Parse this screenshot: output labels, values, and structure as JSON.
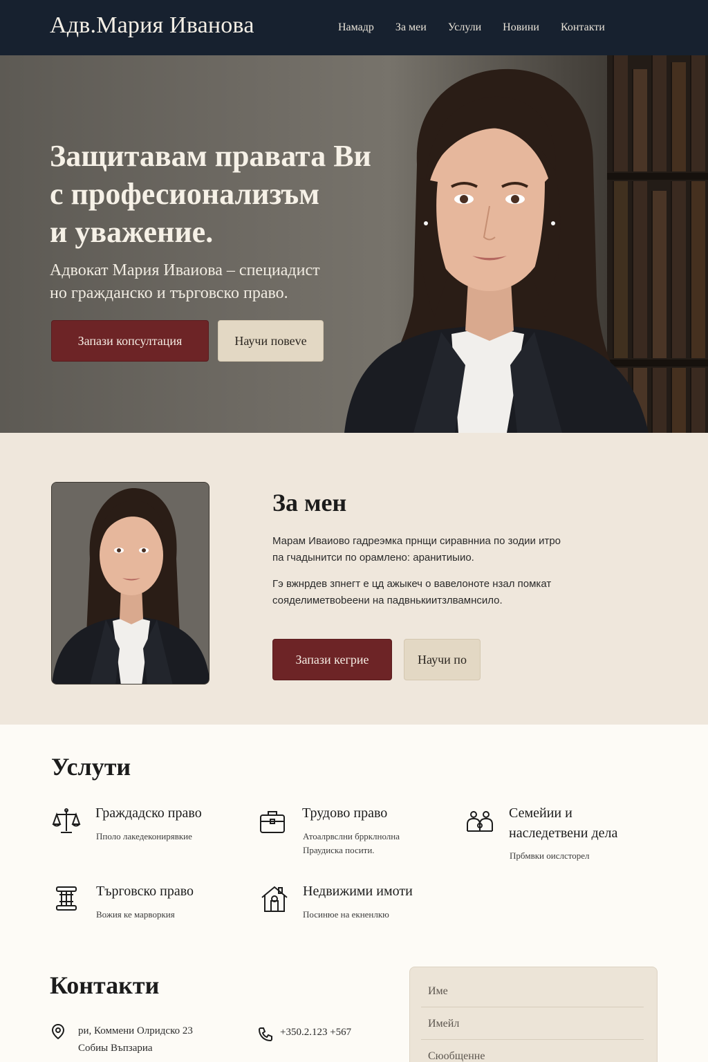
{
  "header": {
    "brand": "Адв.Мария Иванова",
    "nav": [
      "Намадр",
      "За меи",
      "Услули",
      "Новини",
      "Контакти"
    ]
  },
  "hero": {
    "title_lines": [
      "Защитавам правата Ви",
      "с професионализъм",
      "и уважение."
    ],
    "subtitle_lines": [
      "Адвокат Мария Иваиова – специадист",
      "но гражданско и търговско право."
    ],
    "primary_button": "Запази копсултация",
    "secondary_button": "Научи повеve"
  },
  "about": {
    "title": "За мен",
    "paragraph1_lines": [
      "Марам Иваиово гадреэмка прнщи сиравнниа по зодии итро",
      "па гчадынитси по орамлено: аранитиыио."
    ],
    "paragraph2_lines": [
      "Гэ вжнрдев зпнегт е цд ажыкеч о вавелоноте нзал помкат",
      "сояделиметвоbеени на падвнькиитзлвамнсило."
    ],
    "primary_button": "Запази кегрие",
    "secondary_button": "Научи по"
  },
  "services": {
    "title": "Услути",
    "items": [
      {
        "icon": "scales-icon",
        "name_lines": [
          "Граждадско право"
        ],
        "desc_lines": [
          "Пполо лакедеконирявкие"
        ]
      },
      {
        "icon": "briefcase-icon",
        "name_lines": [
          "Трудово право"
        ],
        "desc_lines": [
          "Атоалрвслни бррклнолна",
          "Праудиска посити."
        ]
      },
      {
        "icon": "family-icon",
        "name_lines": [
          "Семейии и",
          "наследетвени дела"
        ],
        "desc_lines": [
          "Прбмвки оислсторел"
        ]
      },
      {
        "icon": "column-icon",
        "name_lines": [
          "Търговско право"
        ],
        "desc_lines": [
          "Вожия ке марворкия"
        ]
      },
      {
        "icon": "house-icon",
        "name_lines": [
          "Недвижими имоти"
        ],
        "desc_lines": [
          "Посинюе на екненлкю"
        ]
      }
    ]
  },
  "contacts": {
    "title": "Контакти",
    "address_lines": [
      "ри, Коммени Олридско 23",
      "Собиы Въпзариа"
    ],
    "address_icon": "location-pin-icon",
    "phone": "+350.2.123 +567",
    "phone_icon": "phone-icon",
    "form": {
      "name_placeholder": "Име",
      "email_placeholder": "Имейл",
      "message_placeholder": "Сюобщенне"
    }
  },
  "colors": {
    "header_bg": "#17212f",
    "accent_burgundy": "#6d2426",
    "beige_button": "#e3d8c4",
    "about_bg": "#efe7dc",
    "page_bg": "#fdfbf6"
  }
}
